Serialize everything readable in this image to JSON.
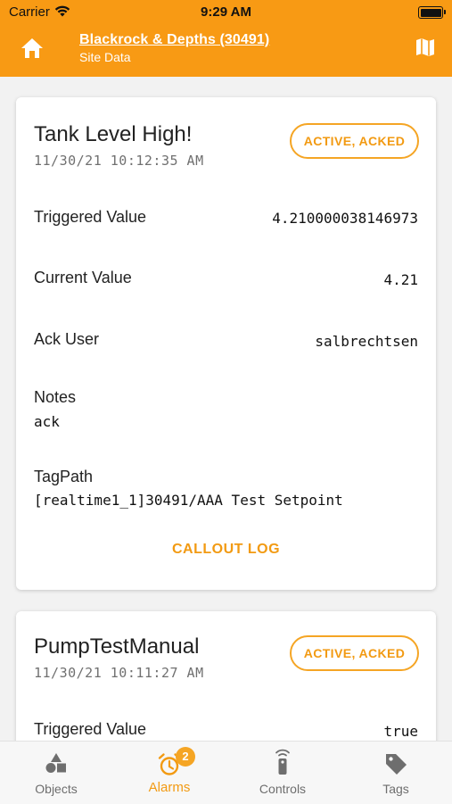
{
  "status_bar": {
    "carrier": "Carrier",
    "time": "9:29 AM"
  },
  "header": {
    "site_title": "Blackrock & Depths (30491)",
    "site_subtitle": "Site Data",
    "home_icon": "home-icon",
    "map_icon": "map-icon",
    "background_color": "#f89a14"
  },
  "alarms": [
    {
      "name": "Tank Level High!",
      "timestamp": "11/30/21 10:12:35 AM",
      "state": "ACTIVE, ACKED",
      "triggered_label": "Triggered Value",
      "triggered_value": "4.210000038146973",
      "current_label": "Current Value",
      "current_value": "4.21",
      "ack_user_label": "Ack User",
      "ack_user_value": "salbrechtsen",
      "notes_label": "Notes",
      "notes_value": "ack",
      "tagpath_label": "TagPath",
      "tagpath_value": "[realtime1_1]30491/AAA Test Setpoint",
      "callout_label": "CALLOUT LOG"
    },
    {
      "name": "PumpTestManual",
      "timestamp": "11/30/21 10:11:27 AM",
      "state": "ACTIVE, ACKED",
      "triggered_label": "Triggered Value",
      "triggered_value": "true"
    }
  ],
  "tabs": [
    {
      "label": "Objects",
      "icon": "objects-icon",
      "active": false
    },
    {
      "label": "Alarms",
      "icon": "alarm-clock-icon",
      "active": true,
      "badge": "2"
    },
    {
      "label": "Controls",
      "icon": "remote-control-icon",
      "active": false
    },
    {
      "label": "Tags",
      "icon": "tag-icon",
      "active": false
    }
  ],
  "accent_color": "#f29a12"
}
